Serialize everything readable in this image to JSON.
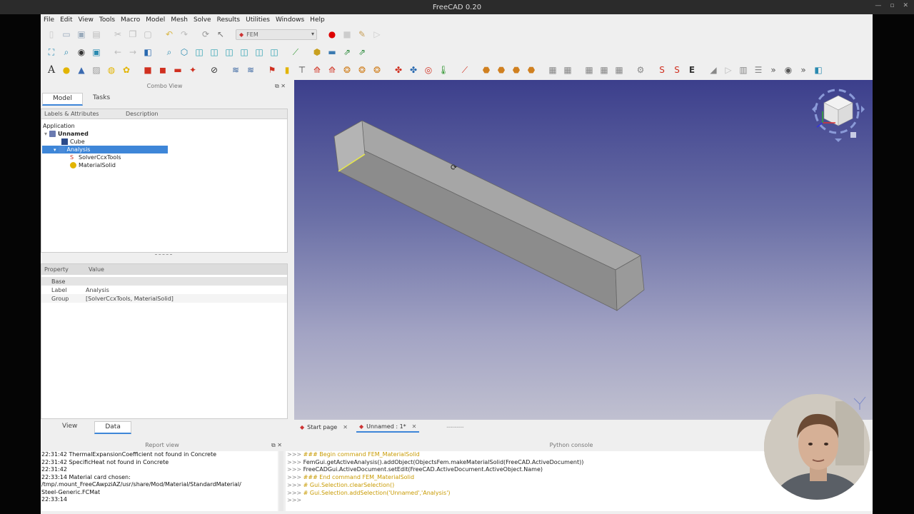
{
  "window": {
    "title": "FreeCAD 0.20"
  },
  "menu": [
    "File",
    "Edit",
    "View",
    "Tools",
    "Macro",
    "Model",
    "Mesh",
    "Solve",
    "Results",
    "Utilities",
    "Windows",
    "Help"
  ],
  "toolbar": {
    "workbench": "FEM"
  },
  "combo_view": {
    "title": "Combo View",
    "tabs": [
      "Model",
      "Tasks"
    ],
    "tree_headers": [
      "Labels & Attributes",
      "Description"
    ],
    "tree": {
      "root": "Application",
      "doc": "Unnamed",
      "cube": "Cube",
      "analysis": "Analysis",
      "solver": "SolverCcxTools",
      "material": "MaterialSolid"
    },
    "prop_headers": [
      "Property",
      "Value"
    ],
    "prop_group": "Base",
    "props": [
      {
        "k": "Label",
        "v": "Analysis"
      },
      {
        "k": "Group",
        "v": "[SolverCcxTools, MaterialSolid]"
      }
    ],
    "bottom_tabs": [
      "View",
      "Data"
    ]
  },
  "doc_tabs": [
    {
      "label": "Start page",
      "close": "✕"
    },
    {
      "label": "Unnamed : 1*",
      "close": "✕"
    }
  ],
  "report": {
    "title": "Report view",
    "lines": [
      "22:31:42  ThermalExpansionCoefficient not found in Concrete",
      "22:31:42  SpecificHeat not found in Concrete",
      "22:31:42",
      "22:33:14  Material card chosen:",
      "  /tmp/.mount_FreeCAwpziAZ/usr/share/Mod/Material/StandardMaterial/",
      "Steel-Generic.FCMat",
      "22:33:14"
    ]
  },
  "python": {
    "title": "Python console",
    "lines": [
      {
        "p": ">>>",
        "t": "### Begin command FEM_MaterialSolid",
        "c": "pg"
      },
      {
        "p": ">>>",
        "t": "FemGui.getActiveAnalysis().addObject(ObjectsFem.makeMaterialSolid(FreeCAD.ActiveDocument))",
        "c": "pk"
      },
      {
        "p": ">>>",
        "t": "FreeCADGui.ActiveDocument.setEdit(FreeCAD.ActiveDocument.ActiveObject.Name)",
        "c": "pk"
      },
      {
        "p": ">>>",
        "t": "### End command FEM_MaterialSolid",
        "c": "pg"
      },
      {
        "p": ">>>",
        "t": "# Gui.Selection.clearSelection()",
        "c": "pg"
      },
      {
        "p": ">>>",
        "t": "# Gui.Selection.addSelection('Unnamed','Analysis')",
        "c": "pg"
      },
      {
        "p": ">>>",
        "t": "",
        "c": "pk"
      }
    ]
  },
  "colors": {
    "selection": "#3e86d8",
    "viewport_top": "#3c3f8c",
    "viewport_bottom": "#c0c0d0"
  }
}
